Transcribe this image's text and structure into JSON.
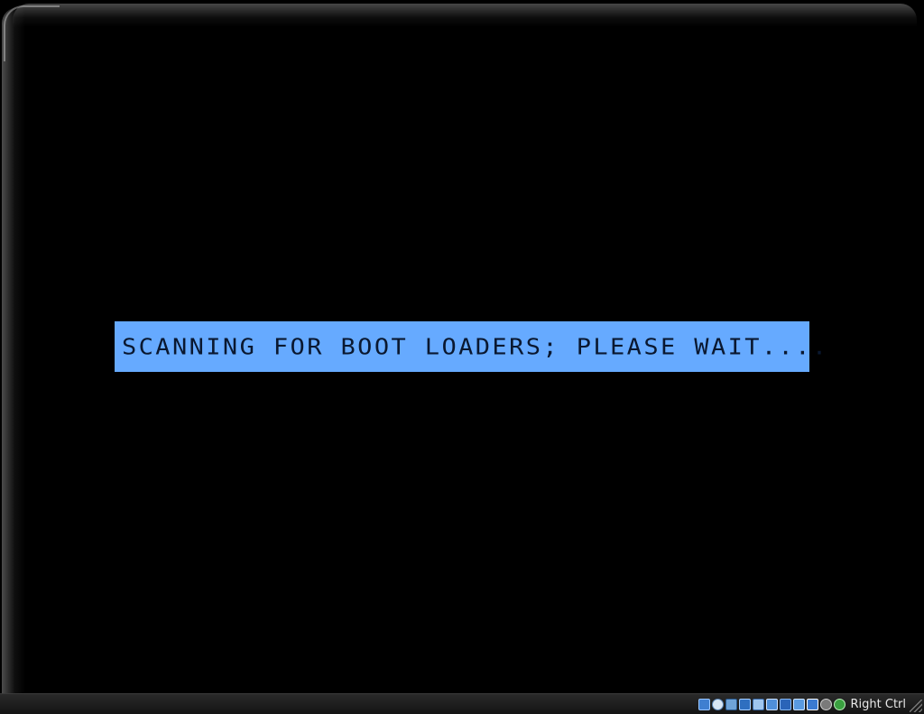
{
  "screen": {
    "boot_message": "SCANNING FOR BOOT LOADERS; PLEASE WAIT....",
    "banner_color": "#66aaff",
    "background_color": "#000000"
  },
  "statusbar": {
    "icons": [
      "hard-disk-icon",
      "optical-drive-icon",
      "audio-icon",
      "network-icon",
      "usb-icon",
      "shared-folders-icon",
      "display-icon",
      "video-capture-icon",
      "virtualization-icon",
      "cpu-icon",
      "mouse-integration-icon"
    ],
    "host_key": "Right Ctrl"
  }
}
